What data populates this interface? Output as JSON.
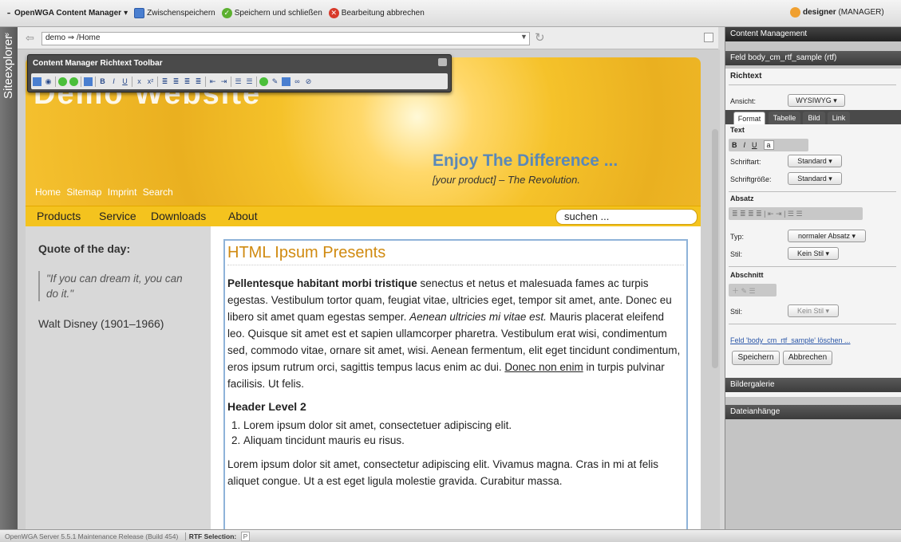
{
  "topbar": {
    "app_menu": "OpenWGA Content Manager",
    "save": "Zwischenspeichern",
    "save_close": "Speichern und schließen",
    "cancel": "Bearbeitung abbrechen",
    "user": "designer",
    "role": "(MANAGER)"
  },
  "left_strip": {
    "label": "Siteexplorer"
  },
  "address": {
    "url": "demo ⇒ /Home"
  },
  "site": {
    "logo": "Demo Website",
    "slogan": "Enjoy The Difference ...",
    "tagline": "[your product] – The Revolution.",
    "top_links": [
      "Home",
      "Sitemap",
      "Imprint",
      "Search"
    ],
    "nav": [
      "Products",
      "Service",
      "Downloads",
      "About"
    ],
    "search": "suchen ...",
    "quote_title": "Quote of the day:",
    "quote": "\"If you can dream it, you can do it.\"",
    "quote_author": "Walt Disney (1901–1966)",
    "heading": "HTML Ipsum Presents",
    "p1_bold": "Pellentesque habitant morbi tristique",
    "p1_a": " senectus et netus et malesuada fames ac turpis egestas. Vestibulum tortor quam, feugiat vitae, ultricies eget, tempor sit amet, ante. Donec eu libero sit amet quam egestas semper. ",
    "p1_em": "Aenean ultricies mi vitae est.",
    "p1_b": " Mauris placerat eleifend leo. Quisque sit amet est et sapien ullamcorper pharetra. Vestibulum erat wisi, condimentum sed, commodo vitae, ornare sit amet, wisi. Aenean fermentum, elit eget tincidunt condimentum, eros ipsum rutrum orci, sagittis tempus lacus enim ac dui. ",
    "p1_link": "Donec non enim",
    "p1_c": " in turpis pulvinar facilisis. Ut felis.",
    "h2": "Header Level 2",
    "list": [
      "Lorem ipsum dolor sit amet, consectetuer adipiscing elit.",
      "Aliquam tincidunt mauris eu risus."
    ],
    "p2": "Lorem ipsum dolor sit amet, consectetur adipiscing elit. Vivamus magna. Cras in mi at felis aliquet congue. Ut a est eget ligula molestie gravida. Curabitur massa."
  },
  "rtf_toolbar": {
    "title": "Content Manager Richtext Toolbar"
  },
  "panel": {
    "header": "Content Management",
    "field_header": "Feld body_cm_rtf_sample (rtf)",
    "section_title": "Richtext",
    "view_label": "Ansicht:",
    "view_value": "WYSIWYG",
    "tabs": [
      "Format",
      "Tabelle",
      "Bild",
      "Link"
    ],
    "text_label": "Text",
    "font_label": "Schriftart:",
    "font_value": "Standard",
    "size_label": "Schriftgröße:",
    "size_value": "Standard",
    "para_label": "Absatz",
    "type_label": "Typ:",
    "type_value": "normaler Absatz",
    "style_label": "Stil:",
    "style_value": "Kein Stil",
    "section_label": "Abschnitt",
    "style2_label": "Stil:",
    "style2_value": "Kein Stil",
    "delete_link": "Feld 'body_cm_rtf_sample' löschen ...",
    "save_btn": "Speichern",
    "cancel_btn": "Abbrechen",
    "gallery": "Bildergalerie",
    "attachments": "Dateianhänge"
  },
  "status": {
    "server": "OpenWGA Server 5.5.1 Maintenance Release (Build 454)",
    "rtf_label": "RTF Selection:",
    "rtf_value": "P"
  }
}
